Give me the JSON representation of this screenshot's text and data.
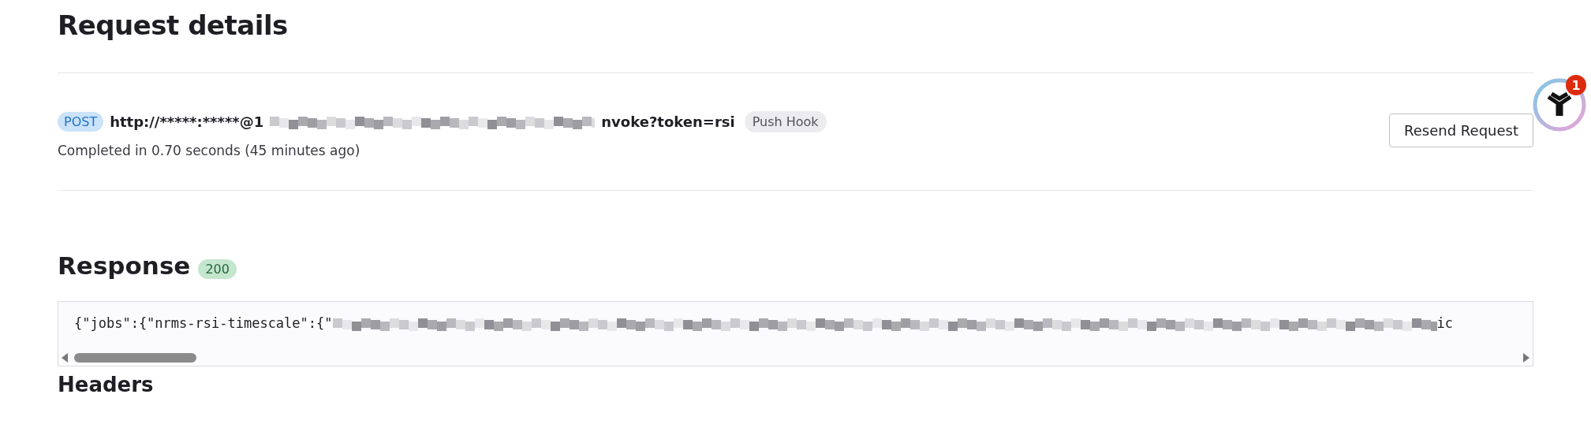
{
  "title": "Request details",
  "request": {
    "method": "POST",
    "url_start": "http://*****:*****@1",
    "url_end": "nvoke?token=rsi",
    "tag": "Push Hook",
    "completed": "Completed in 0.70 seconds (45 minutes ago)",
    "resend_button": "Resend Request"
  },
  "notification_badge": "1",
  "response": {
    "heading": "Response",
    "status": "200",
    "body_start": "{\"jobs\":{\"nrms-rsi-timescale\":{\"",
    "body_end": "ic"
  },
  "headers_heading": "Headers"
}
